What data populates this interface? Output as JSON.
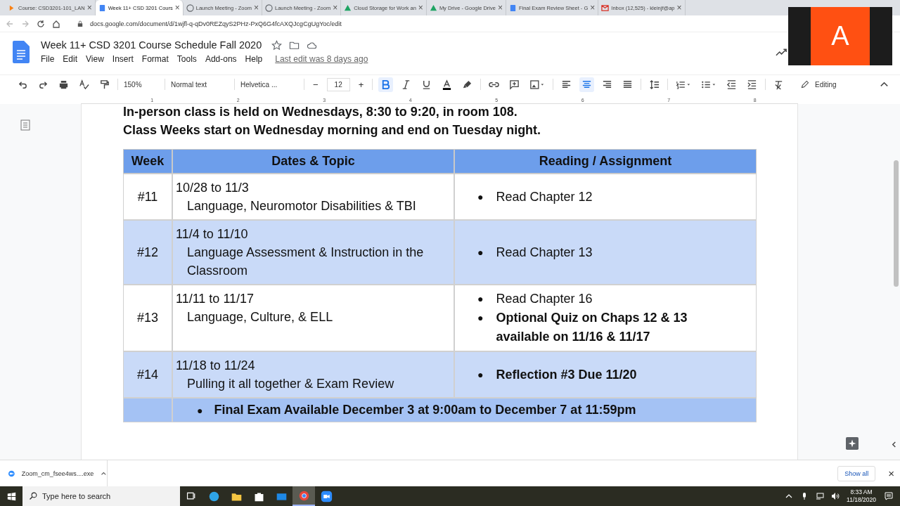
{
  "browser": {
    "tabs": [
      {
        "label": "Course: CSD3201-101_LAN",
        "selected": false
      },
      {
        "label": "Week 11+ CSD 3201 Cours",
        "selected": true
      },
      {
        "label": "Launch Meeting - Zoom",
        "selected": false
      },
      {
        "label": "Launch Meeting - Zoom",
        "selected": false
      },
      {
        "label": "Cloud Storage for Work an",
        "selected": false
      },
      {
        "label": "My Drive - Google Drive",
        "selected": false
      },
      {
        "label": "Final Exam Review Sheet - G",
        "selected": false
      },
      {
        "label": "Inbox (12,525) - kleinjf@ap",
        "selected": false
      }
    ],
    "close_glyph": "×",
    "address": "docs.google.com/document/d/1wjfl-q-qDv0REZqyS2PHz-PxQ6G4fcAXQJcgCgUgYoc/edit"
  },
  "video_tile": {
    "initial": "A"
  },
  "doc_header": {
    "title": "Week 11+ CSD 3201 Course Schedule Fall 2020",
    "menu": [
      "File",
      "Edit",
      "View",
      "Insert",
      "Format",
      "Tools",
      "Add-ons",
      "Help"
    ],
    "last_edit": "Last edit was 8 days ago"
  },
  "toolbar": {
    "zoom": "150%",
    "style": "Normal text",
    "font": "Helvetica ...",
    "size_minus": "−",
    "size": "12",
    "size_plus": "+",
    "bold": true,
    "italic": false,
    "underline": false,
    "align_center": true,
    "mode": "Editing"
  },
  "ruler": [
    "1",
    "2",
    "3",
    "4",
    "5",
    "6",
    "7",
    "8"
  ],
  "document": {
    "intro": [
      "In-person class is held on Wednesdays, 8:30 to 9:20, in room 108.",
      "Class Weeks start on Wednesday morning and end on Tuesday night."
    ],
    "columns": [
      "Week",
      "Dates & Topic",
      "Reading / Assignment"
    ],
    "rows": [
      {
        "week": "#11",
        "dates": "10/28 to 11/3",
        "topic": "Language, Neuromotor Disabilities & TBI",
        "shaded": false,
        "items": [
          {
            "text": "Read Chapter 12",
            "bold": false
          }
        ]
      },
      {
        "week": "#12",
        "dates": "11/4 to 11/10",
        "topic": "Language Assessment & Instruction in the Classroom",
        "shaded": true,
        "items": [
          {
            "text": "Read Chapter 13",
            "bold": false
          }
        ]
      },
      {
        "week": "#13",
        "dates": "11/11 to 11/17",
        "topic": "Language, Culture, & ELL",
        "shaded": false,
        "items": [
          {
            "text": "Read Chapter 16",
            "bold": false
          },
          {
            "text": "Optional Quiz on Chaps 12 & 13 available on 11/16 & 11/17",
            "bold": true
          }
        ]
      },
      {
        "week": "#14",
        "dates": "11/18 to 11/24",
        "topic": "Pulling it all together & Exam Review",
        "shaded": true,
        "items": [
          {
            "text": "Reflection #3 Due 11/20",
            "bold": true
          }
        ]
      }
    ],
    "final_row": "Final Exam Available December 3 at 9:00am to December 7 at 11:59pm",
    "bullet": "●"
  },
  "downloads": {
    "file": "Zoom_cm_fsee4ws....exe",
    "show_all": "Show all",
    "close_glyph": "×"
  },
  "taskbar": {
    "search_placeholder": "Type here to search",
    "apps": [
      {
        "selected": false
      },
      {
        "selected": false
      },
      {
        "selected": false
      },
      {
        "selected": false
      },
      {
        "selected": false
      },
      {
        "selected": true
      },
      {
        "selected": false
      }
    ],
    "time": "8:33 AM",
    "date": "11/18/2020"
  }
}
